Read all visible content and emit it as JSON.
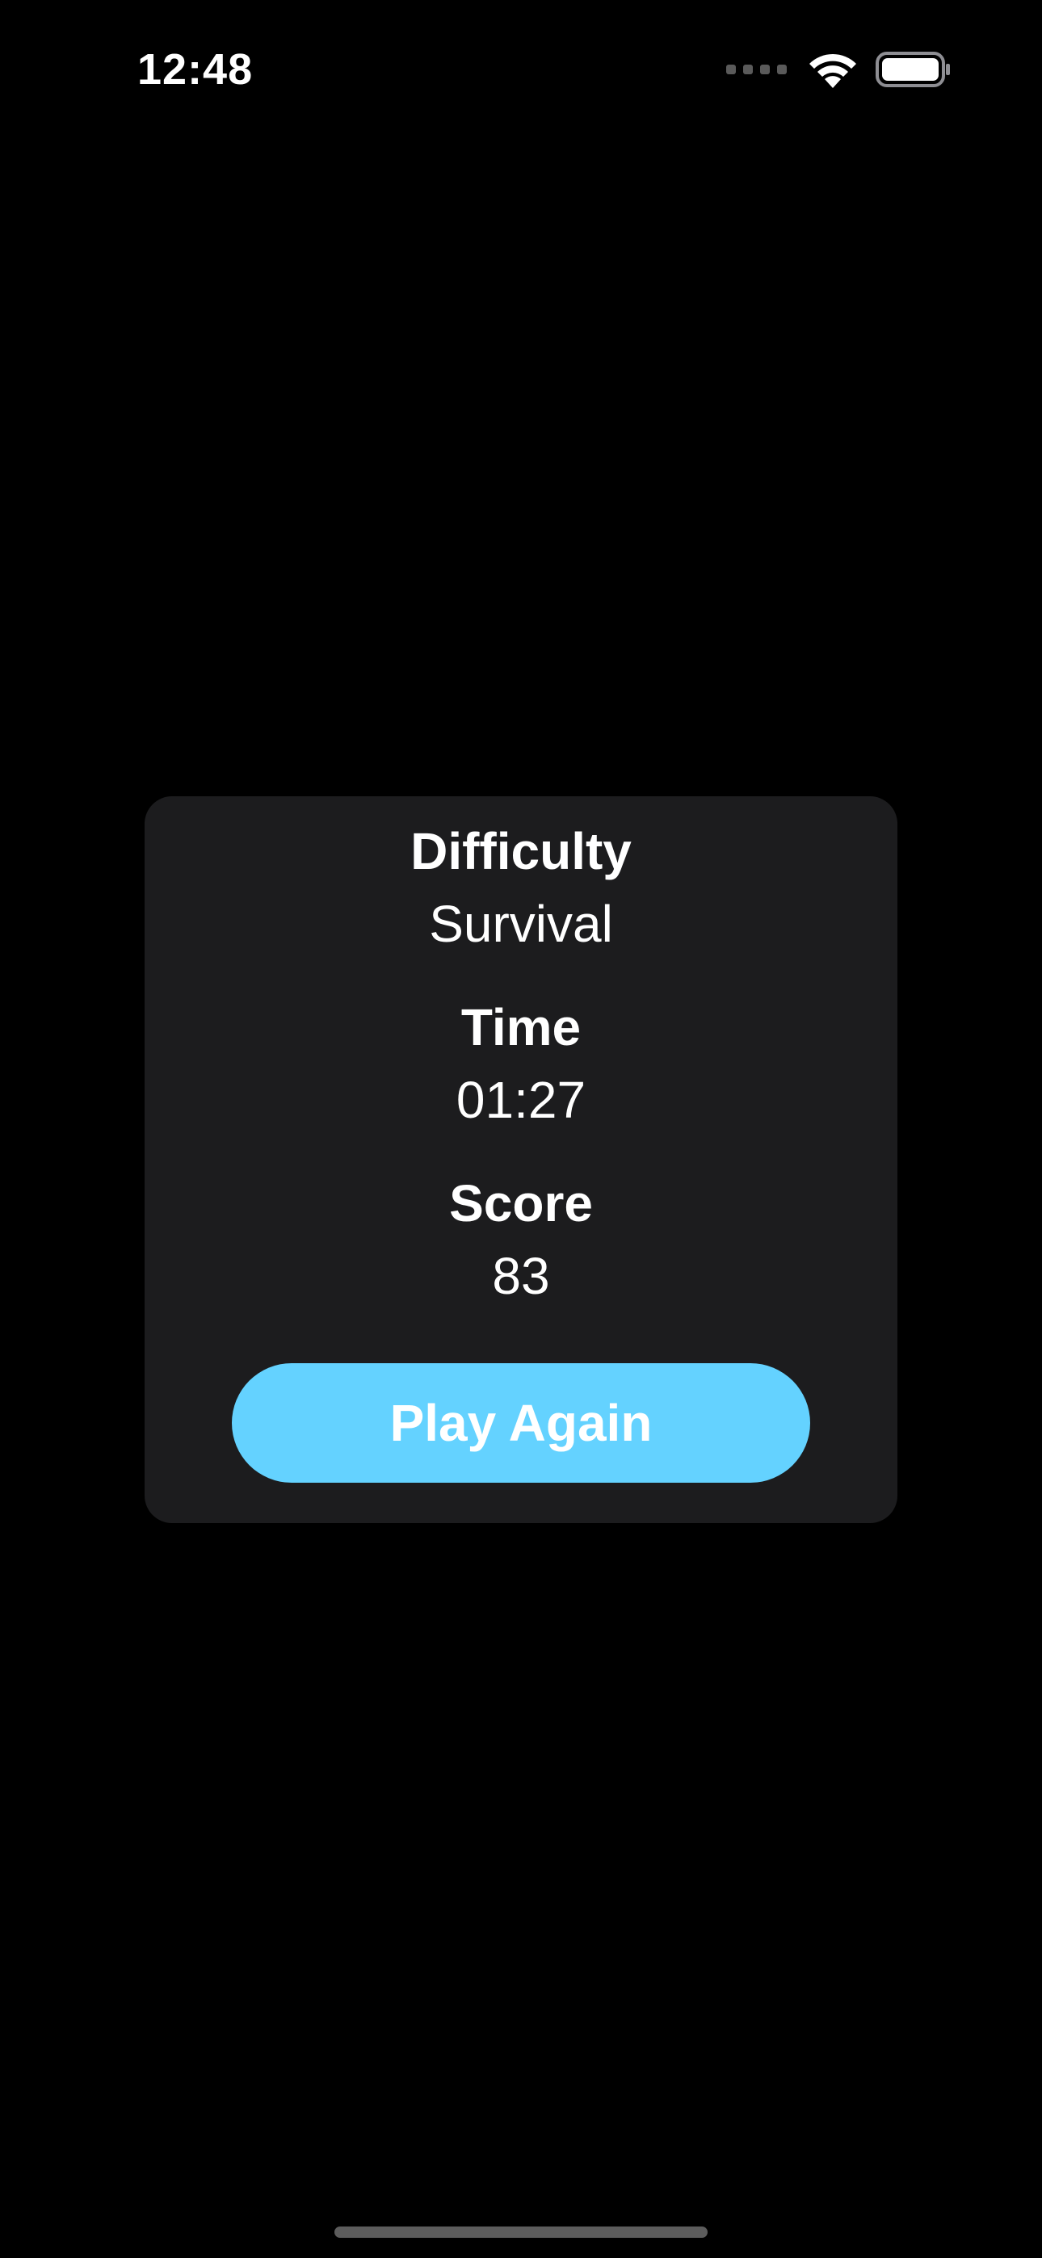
{
  "status_bar": {
    "time": "12:48",
    "icons": [
      "cellular-signal-icon",
      "wifi-icon",
      "battery-icon"
    ]
  },
  "result_card": {
    "difficulty": {
      "label": "Difficulty",
      "value": "Survival"
    },
    "time": {
      "label": "Time",
      "value": "01:27"
    },
    "score": {
      "label": "Score",
      "value": "83"
    },
    "play_again_label": "Play Again"
  },
  "colors": {
    "background": "#000000",
    "card": "#1c1c1e",
    "accent": "#64d2ff",
    "text": "#ffffff"
  }
}
